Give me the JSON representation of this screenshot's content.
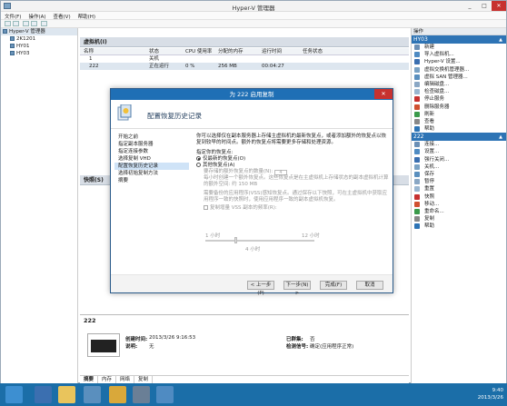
{
  "window": {
    "title": "Hyper-V 管理器",
    "min": "_",
    "max": "□",
    "close": "✕"
  },
  "menu": [
    "文件(F)",
    "操作(A)",
    "查看(V)",
    "帮助(H)"
  ],
  "tree": [
    {
      "label": "Hyper-V 管理器",
      "level": 0
    },
    {
      "label": "2K1201",
      "level": 1
    },
    {
      "label": "HY01",
      "level": 1
    },
    {
      "label": "HY03",
      "level": 1
    }
  ],
  "vms": {
    "title": "虚拟机(I)",
    "columns": [
      "名称",
      "状态",
      "CPU 使用率",
      "分配的内存",
      "运行时间",
      "任务状态"
    ],
    "rows": [
      [
        "1",
        "关机",
        "",
        "",
        "",
        ""
      ],
      [
        "222",
        "正在运行",
        "0 %",
        "256 MB",
        "00:04:27",
        ""
      ]
    ]
  },
  "snapshots": {
    "title": "快照(S)"
  },
  "detail": {
    "title": "222",
    "created_label": "创建时间:",
    "created_value": "2013/3/26 9:16:53",
    "notes_label": "说明:",
    "notes_value": "无",
    "clustered_label": "已群集:",
    "clustered_value": "否",
    "heartbeat_label": "检测信号:",
    "heartbeat_value": "确定(应用程序正常)",
    "tabs": [
      "摘要",
      "内存",
      "网络",
      "复制"
    ]
  },
  "actions": {
    "header": "操作",
    "host": "HY03",
    "host_items": [
      "新建",
      "导入虚拟机...",
      "Hyper-V 设置...",
      "虚拟交换机管理器...",
      "虚拟 SAN 管理器...",
      "编辑磁盘...",
      "检查磁盘...",
      "停止服务",
      "删除服务器",
      "刷新",
      "查看",
      "帮助"
    ],
    "vm": "222",
    "vm_items": [
      "连接...",
      "设置...",
      "强行关闭...",
      "关机...",
      "保存",
      "暂停",
      "重置",
      "快照",
      "移动...",
      "重命名...",
      "复制",
      "帮助"
    ]
  },
  "dialog": {
    "title": "为 222 启用复制",
    "heading": "配置恢复历史记录",
    "close": "✕",
    "steps": [
      "开始之前",
      "指定副本服务器",
      "指定连接参数",
      "选择复制 VHD",
      "配置恢复历史记录",
      "选择初始复制方法",
      "摘要"
    ],
    "current_step": 4,
    "intro": "你可以选择仅在副本服务器上存储主虚拟机的最新恢复点，或者添加额外的恢复点以恢复到较早的时间点。额外的恢复点将需要更多存储和处理资源。",
    "choose_label": "指定你的恢复点:",
    "option_latest": "仅最新的恢复点(O)",
    "option_additional": "其他恢复点(A)",
    "spin_label": "要存储的额外恢复点的数量(N):",
    "spin_value": "4",
    "additional_note": "每小时创建一个额外恢复点。这些恢复点是在主虚拟机上存储状态的副本虚拟机计算的额外空间: 约 150 MB",
    "vss_note": "需要备份的应用程序(VSS)感知恢复点。通过保存以下快照，可在主虚拟机中获取应用程序一致的快照时，使用应用程序一致的副本虚拟机恢复。",
    "vss_check": "复制增量 VSS 副本的频率(R):",
    "slider_min": "1 小时",
    "slider_max": "12 小时",
    "slider_value": "4 小时",
    "buttons": {
      "prev": "< 上一步(P)",
      "next": "下一步(N) >",
      "finish": "完成(F)",
      "cancel": "取消"
    }
  },
  "taskbar": {
    "time": "9:40",
    "date": "2013/3/26"
  }
}
